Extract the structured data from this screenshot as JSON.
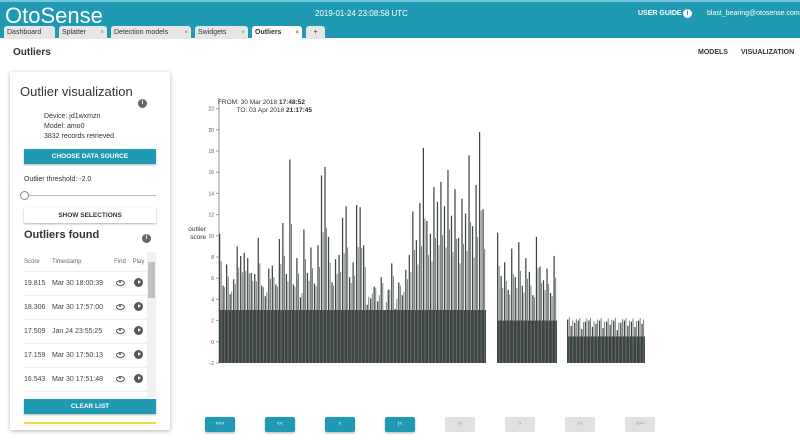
{
  "header": {
    "logo": "OtoSense",
    "datetime": "2019-01-24 23:08:58 UTC",
    "user_guide": "USER GUIDE",
    "email": "blast_bearing@otosense.com"
  },
  "tabs": [
    {
      "label": "Dashboard",
      "closable": false
    },
    {
      "label": "Splatter",
      "closable": true
    },
    {
      "label": "Detection models",
      "closable": true
    },
    {
      "label": "Swidgets",
      "closable": true
    },
    {
      "label": "Outliers",
      "closable": true,
      "active": true
    },
    {
      "label": "+",
      "closable": false
    }
  ],
  "page": {
    "title": "Outliers",
    "nav": [
      "MODELS",
      "VISUALIZATION"
    ]
  },
  "panel": {
    "title": "Outlier visualization",
    "device": "Device: jd1wxmzn",
    "model": "Model: amo0",
    "records": "3832 records retrieved",
    "choose_btn": "CHOOSE DATA SOURCE",
    "threshold_label": "Outlier threshold: -2.0",
    "threshold_value": -2.0,
    "show_btn": "SHOW SELECTIONS",
    "found_title": "Outliers found",
    "columns": [
      "Score",
      "Timestamp",
      "Find",
      "Play"
    ],
    "rows": [
      {
        "score": "19.815",
        "ts": "Mar 30 18:00:39"
      },
      {
        "score": "18.306",
        "ts": "Mar 30 17:57:00"
      },
      {
        "score": "17.509",
        "ts": "Jan 24 23:55:25"
      },
      {
        "score": "17.159",
        "ts": "Mar 30 17:50:13"
      },
      {
        "score": "16.543",
        "ts": "Mar 30 17:51:48"
      }
    ],
    "clear_btn": "CLEAR LIST"
  },
  "pager": [
    {
      "label": "<<<",
      "enabled": true
    },
    {
      "label": "<<",
      "enabled": true
    },
    {
      "label": "<",
      "enabled": true
    },
    {
      "label": "|<",
      "enabled": true
    },
    {
      "label": ">|",
      "enabled": false
    },
    {
      "label": ">",
      "enabled": false
    },
    {
      "label": ">>",
      "enabled": false
    },
    {
      "label": ">>>",
      "enabled": false
    }
  ],
  "chart_data": {
    "type": "bar",
    "ylabel": "outlier score",
    "from_label": "FROM: 30 Mar 2018 ",
    "from_time": "17:48:52",
    "to_label": "TO: 03 Apr 2018 ",
    "to_time": "21:17:45",
    "ylim": [
      -2,
      23
    ],
    "yticks": [
      -2,
      0,
      2,
      4,
      6,
      8,
      10,
      12,
      14,
      16,
      18,
      20,
      22
    ],
    "grid": false,
    "color": "#3d4444",
    "segments": [
      {
        "floor": 3,
        "values": [
          10.2,
          5.3,
          7.3,
          4.5,
          5.9,
          9,
          8.1,
          8.4,
          7.9,
          6.5,
          6.4,
          9.8,
          5.3,
          4.3,
          6.9,
          7.2,
          5.4,
          9.7,
          11.2,
          6.4,
          17.2,
          5.4,
          7.9,
          4.2,
          10.6,
          6.5,
          8.9,
          5.5,
          9.1,
          15.7,
          16.5,
          9.9,
          5.6,
          7.8,
          8.2,
          11.7,
          12.8,
          6.1,
          7.5,
          12.9,
          12.7,
          9.1,
          3.5,
          4.1,
          5.2,
          3.8,
          6.1,
          2.5,
          4.9,
          7.4,
          3.1,
          5.6,
          4.4,
          6.8,
          8.2,
          12.3,
          9.6,
          13.1,
          18.3,
          11.4,
          10.2,
          14.6,
          13.2,
          15.1,
          12.8,
          16.2,
          11.9,
          14.4,
          9.8,
          13.5,
          12.1,
          17.6,
          10.9,
          14.8,
          19.8,
          12.5
        ]
      },
      {
        "floor": 2,
        "values": [
          10.3,
          6.2,
          7.5,
          4.9,
          8.8,
          6.1,
          9.4,
          5.3,
          7.9,
          6.6,
          4.4,
          9.9,
          7.1,
          5.8,
          6.9,
          4.6,
          8.1
        ]
      },
      {
        "floor": 0.5,
        "values": [
          2.1,
          1.5,
          1.8,
          2.0,
          1.2,
          1.9,
          2.0,
          1.4,
          1.7,
          2.0,
          1.3,
          1.9,
          1.6,
          2.0,
          1.1,
          1.8,
          2.0,
          1.5,
          1.9,
          1.4,
          2.0,
          1.7
        ]
      }
    ]
  }
}
